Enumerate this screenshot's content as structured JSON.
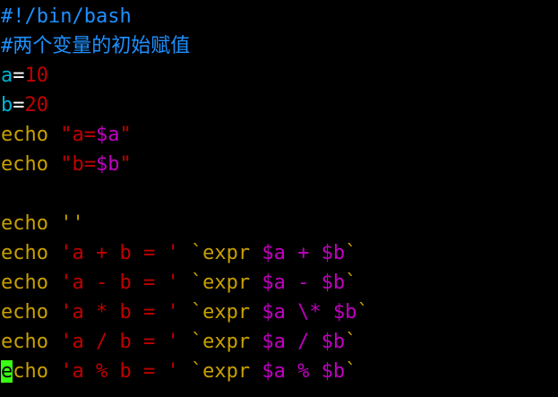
{
  "theme": {
    "background": "#000000",
    "comment": "#1e90ff",
    "variable": "#00b4d8",
    "number": "#c00000",
    "keyword": "#c8a000",
    "string": "#c00000",
    "expansion": "#c000c0",
    "operator": "#ffffff",
    "cursor": "#39ff14"
  },
  "editor": {
    "lines": [
      [
        {
          "t": "#!/bin/bash",
          "c": "comment"
        }
      ],
      [
        {
          "t": "#两个变量的初始赋值",
          "c": "comment"
        }
      ],
      [
        {
          "t": "a",
          "c": "variable"
        },
        {
          "t": "=",
          "c": "operator"
        },
        {
          "t": "10",
          "c": "number"
        }
      ],
      [
        {
          "t": "b",
          "c": "variable"
        },
        {
          "t": "=",
          "c": "operator"
        },
        {
          "t": "20",
          "c": "number"
        }
      ],
      [
        {
          "t": "echo ",
          "c": "keyword"
        },
        {
          "t": "\"a=",
          "c": "string"
        },
        {
          "t": "$a",
          "c": "expansion"
        },
        {
          "t": "\"",
          "c": "string"
        }
      ],
      [
        {
          "t": "echo ",
          "c": "keyword"
        },
        {
          "t": "\"b=",
          "c": "string"
        },
        {
          "t": "$b",
          "c": "expansion"
        },
        {
          "t": "\"",
          "c": "string"
        }
      ],
      [],
      [
        {
          "t": "echo ",
          "c": "keyword"
        },
        {
          "t": "''",
          "c": "keyword"
        }
      ],
      [
        {
          "t": "echo ",
          "c": "keyword"
        },
        {
          "t": "'a + b = '",
          "c": "string"
        },
        {
          "t": " `expr ",
          "c": "keyword"
        },
        {
          "t": "$a + $b",
          "c": "expansion"
        },
        {
          "t": "`",
          "c": "keyword"
        }
      ],
      [
        {
          "t": "echo ",
          "c": "keyword"
        },
        {
          "t": "'a - b = '",
          "c": "string"
        },
        {
          "t": " `expr ",
          "c": "keyword"
        },
        {
          "t": "$a - $b",
          "c": "expansion"
        },
        {
          "t": "`",
          "c": "keyword"
        }
      ],
      [
        {
          "t": "echo ",
          "c": "keyword"
        },
        {
          "t": "'a * b = '",
          "c": "string"
        },
        {
          "t": " `expr ",
          "c": "keyword"
        },
        {
          "t": "$a \\* $b",
          "c": "expansion"
        },
        {
          "t": "`",
          "c": "keyword"
        }
      ],
      [
        {
          "t": "echo ",
          "c": "keyword"
        },
        {
          "t": "'a / b = '",
          "c": "string"
        },
        {
          "t": " `expr ",
          "c": "keyword"
        },
        {
          "t": "$a / $b",
          "c": "expansion"
        },
        {
          "t": "`",
          "c": "keyword"
        }
      ],
      [
        {
          "t": "e",
          "c": "keyword",
          "cursor": true
        },
        {
          "t": "cho ",
          "c": "keyword"
        },
        {
          "t": "'a % b = '",
          "c": "string"
        },
        {
          "t": " `expr ",
          "c": "keyword"
        },
        {
          "t": "$a % $b",
          "c": "expansion"
        },
        {
          "t": "`",
          "c": "keyword"
        }
      ]
    ]
  }
}
